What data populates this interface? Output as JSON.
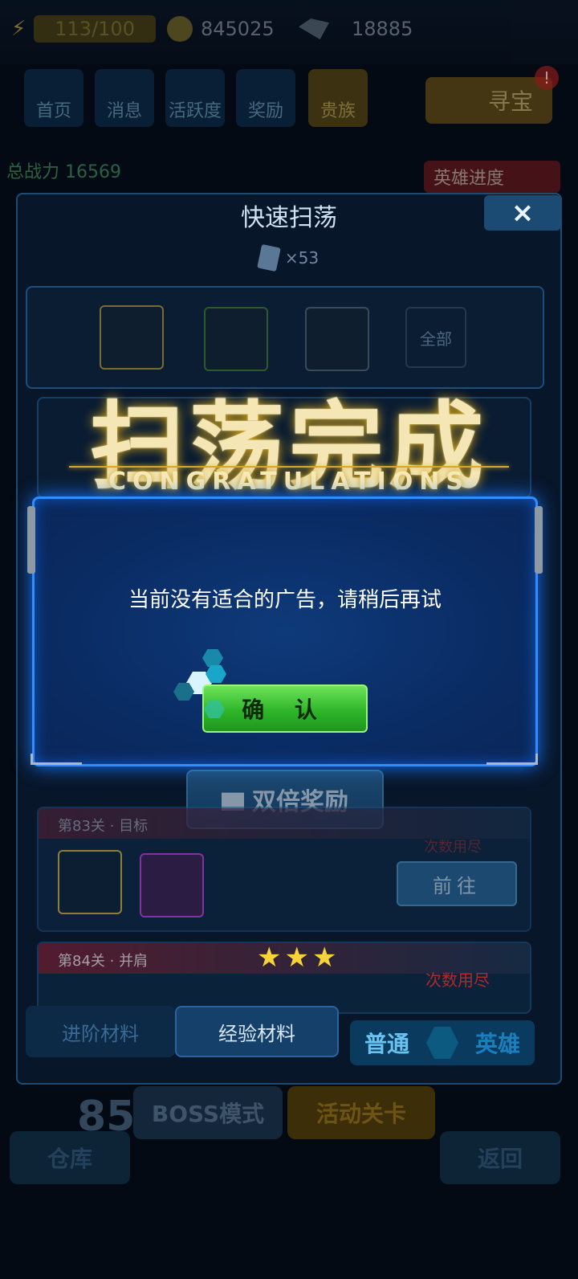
{
  "topbar": {
    "energy": "113/100",
    "gold": "845025",
    "gems": "18885"
  },
  "nav": [
    {
      "label": "首页"
    },
    {
      "label": "消息"
    },
    {
      "label": "活跃度"
    },
    {
      "label": "奖励"
    },
    {
      "label": "贵族"
    }
  ],
  "treasure": {
    "label": "寻宝",
    "badge": "!"
  },
  "power": {
    "label": "总战力",
    "value": "16569"
  },
  "hero_progress": "英雄进度",
  "sweep": {
    "title": "快速扫荡",
    "close": "×",
    "ticket_count": "×53",
    "all_label": "全部",
    "banner_cn": "扫荡完成",
    "banner_en": "CONGRATULATIONS",
    "double_reward": "双倍奖励",
    "stages": [
      {
        "name": "第83关 · 目标",
        "action": "前往",
        "note": "次数用尽"
      },
      {
        "name": "第84关 · 并肩",
        "note": "次数用尽"
      }
    ],
    "tabs": {
      "advanced": "进阶材料",
      "exp": "经验材料"
    },
    "mode_switch": {
      "normal": "普通",
      "hero": "英雄"
    }
  },
  "dialog": {
    "message": "当前没有适合的广告，请稍后再试",
    "confirm": "确 认"
  },
  "bottom": {
    "level": "85",
    "boss": "BOSS模式",
    "event": "活动关卡",
    "warehouse": "仓库",
    "back": "返回"
  }
}
